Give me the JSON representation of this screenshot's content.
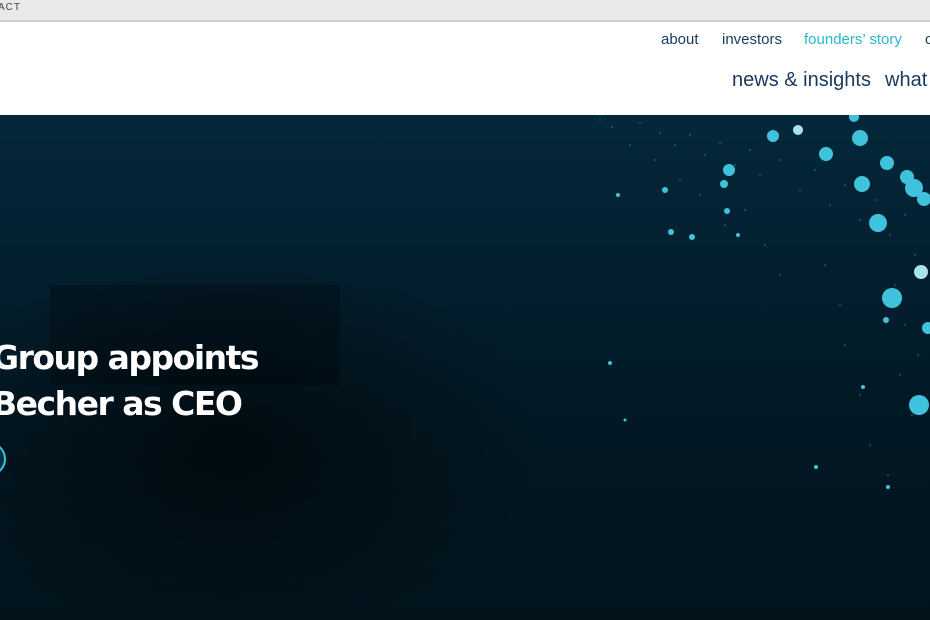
{
  "browser": {
    "top_text": "ACT"
  },
  "header": {
    "utility_nav": [
      {
        "label": "about",
        "active": false
      },
      {
        "label": "investors",
        "active": false
      },
      {
        "label": "founders’ story",
        "active": true
      },
      {
        "label": "c",
        "active": false
      }
    ],
    "main_nav": [
      {
        "label": "news & insights"
      },
      {
        "label": "what"
      }
    ]
  },
  "hero": {
    "title_line_1": "Group appoints",
    "title_line_2": "Becher as CEO"
  },
  "colors": {
    "nav_text": "#173a5e",
    "nav_active": "#2bb6d2",
    "hero_background": "#031e2d",
    "accent_cyan": "#3fc3dc"
  },
  "icons": {
    "hero_button": "circle-arrow-icon"
  }
}
